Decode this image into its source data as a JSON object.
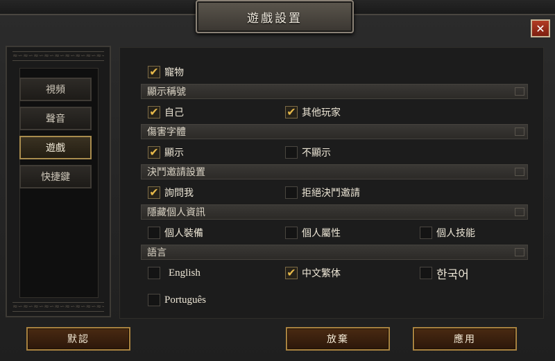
{
  "window": {
    "title": "遊戲設置",
    "close_symbol": "✕"
  },
  "sidebar": {
    "ornament": "≈∽≈∽≈∽≈∽≈∽≈∽≈∽≈∽≈∽",
    "items": [
      {
        "label": "視頻",
        "active": false
      },
      {
        "label": "聲音",
        "active": false
      },
      {
        "label": "遊戲",
        "active": true
      },
      {
        "label": "快捷鍵",
        "active": false
      }
    ]
  },
  "check_glyph": "✔",
  "options": {
    "pet": {
      "label": "寵物",
      "checked": true
    }
  },
  "sections": [
    {
      "title": "顯示稱號",
      "options": [
        {
          "label": "自己",
          "checked": true
        },
        {
          "label": "其他玩家",
          "checked": true
        }
      ]
    },
    {
      "title": "傷害字體",
      "options": [
        {
          "label": "顯示",
          "checked": true
        },
        {
          "label": "不顯示",
          "checked": false
        }
      ]
    },
    {
      "title": "決鬥邀請設置",
      "options": [
        {
          "label": "詢問我",
          "checked": true
        },
        {
          "label": "拒絕決鬥邀請",
          "checked": false
        }
      ]
    },
    {
      "title": "隱藏個人資訊",
      "options": [
        {
          "label": "個人裝備",
          "checked": false
        },
        {
          "label": "個人屬性",
          "checked": false
        },
        {
          "label": "個人技能",
          "checked": false
        }
      ]
    },
    {
      "title": "語言",
      "options": [
        {
          "label": "English",
          "checked": false
        },
        {
          "label": "中文繁体",
          "checked": true
        },
        {
          "label": "한국어",
          "checked": false
        },
        {
          "label": "Português",
          "checked": false
        }
      ]
    }
  ],
  "footer": {
    "default_label": "默認",
    "discard_label": "放棄",
    "apply_label": "應用"
  },
  "colors": {
    "accent_gold": "#a9823f",
    "check_gold": "#e7b94a",
    "close_red": "#b23b23"
  }
}
